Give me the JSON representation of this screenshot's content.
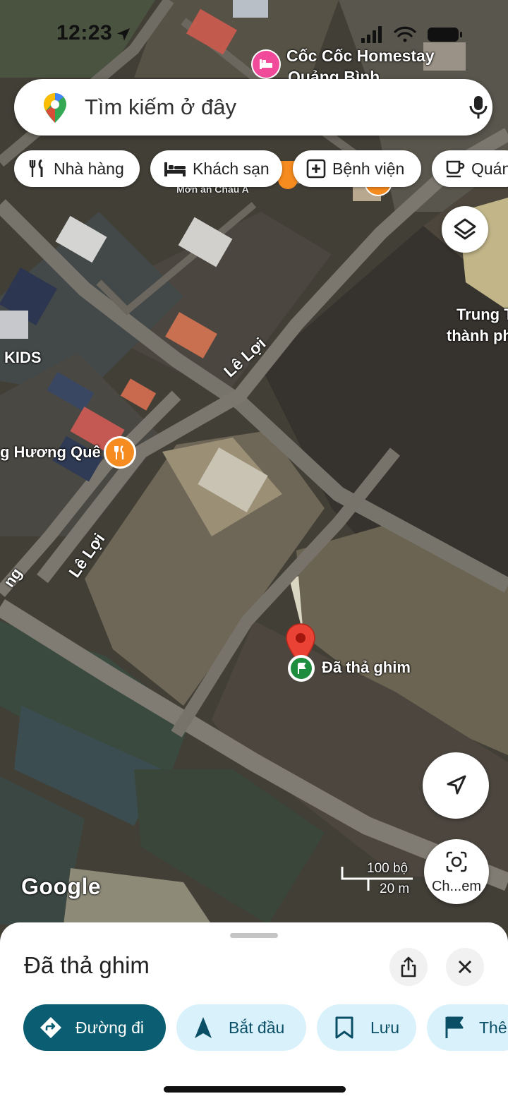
{
  "status_bar": {
    "time": "12:23"
  },
  "search": {
    "placeholder": "Tìm kiếm ở đây"
  },
  "chips": [
    {
      "label": "Nhà hàng",
      "icon": "fork-knife-icon"
    },
    {
      "label": "Khách sạn",
      "icon": "bed-icon"
    },
    {
      "label": "Bệnh viện",
      "icon": "plus-square-icon"
    },
    {
      "label": "Quán",
      "icon": "coffee-cup-icon"
    }
  ],
  "map": {
    "place_labels": {
      "homestay_line1": "Cốc Cốc Homestay",
      "homestay_line2": "Quảng Bình",
      "poi_partial": "Mơn an Châu A",
      "center_line1": "Trung T",
      "center_line2": "thành ph",
      "kids": "KIDS",
      "restaurant": "g Hương Quê",
      "edge_partial": "ng"
    },
    "road_labels": {
      "road_1": "Lê Lợi",
      "road_2": "Lê Lợi"
    },
    "pin_label": "Đã thả ghim",
    "scale": {
      "top": "100 bộ",
      "bottom": "20 m"
    },
    "google_logo": "Google",
    "explore_button_label": "Ch...em"
  },
  "sheet": {
    "title": "Đã thả ghim",
    "actions": {
      "directions": "Đường đi",
      "start": "Bắt đầu",
      "save": "Lưu",
      "more": "Thê"
    }
  },
  "colors": {
    "directions_bg": "#0b5e72",
    "action_bg": "#d9f1fb",
    "action_fg": "#0a4f66",
    "pin_red": "#ea4335",
    "poi_orange": "#f68b1f",
    "poi_pink": "#f24a9b"
  }
}
